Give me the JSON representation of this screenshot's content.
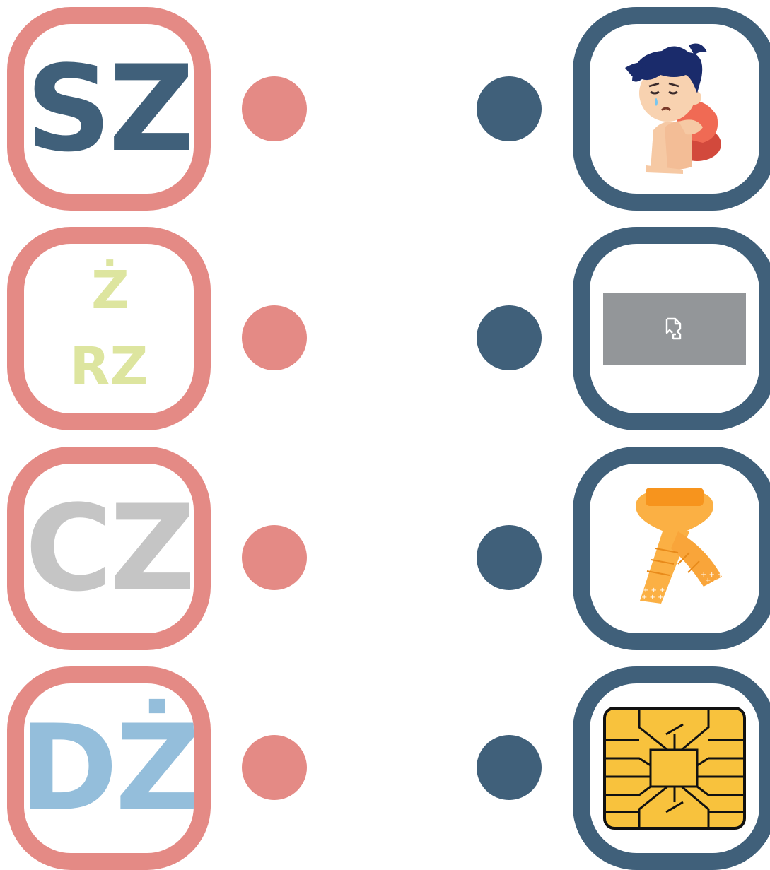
{
  "left_cards": [
    {
      "text": "SZ"
    },
    {
      "line1": "Ż",
      "line2": "RZ"
    },
    {
      "text": "CZ"
    },
    {
      "text": "DŻ"
    }
  ],
  "right_cards": [
    {
      "icon": "sad-boy-icon"
    },
    {
      "icon": "broken-image-icon"
    },
    {
      "icon": "scarf-icon"
    },
    {
      "icon": "sim-chip-icon"
    }
  ],
  "colors": {
    "left_accent": "#e48a85",
    "right_accent": "#40607a",
    "sz": "#40607a",
    "zrz": "#dde59f",
    "cz": "#c5c5c5",
    "dz": "#94bedb",
    "chip": "#f8c23d",
    "scarf": "#fbb044"
  }
}
